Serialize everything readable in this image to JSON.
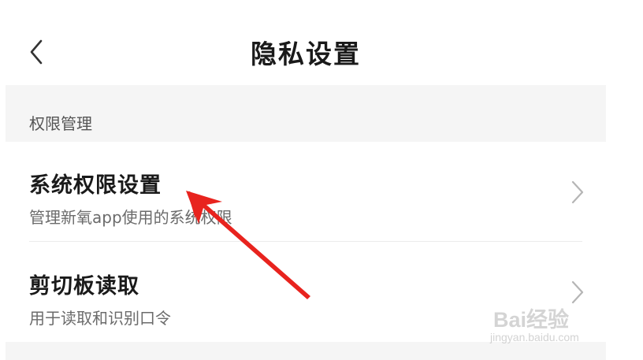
{
  "header": {
    "title": "隐私设置",
    "back_icon": "chevron-left-icon"
  },
  "section": {
    "label": "权限管理"
  },
  "items": [
    {
      "title": "系统权限设置",
      "subtitle": "管理新氧app使用的系统权限",
      "icon": "chevron-right-icon"
    },
    {
      "title": "剪切板读取",
      "subtitle": "用于读取和识别口令",
      "icon": "chevron-right-icon"
    }
  ],
  "annotation": {
    "arrow_color": "#e8231e"
  },
  "watermark": {
    "brand": "Bai经验",
    "url": "jingyan.baidu.com"
  },
  "colors": {
    "section_background": "#f5f5f5",
    "title_text": "#1a1a1a",
    "subtitle_text": "#6b6b6b",
    "chevron": "#b5b5b5"
  }
}
